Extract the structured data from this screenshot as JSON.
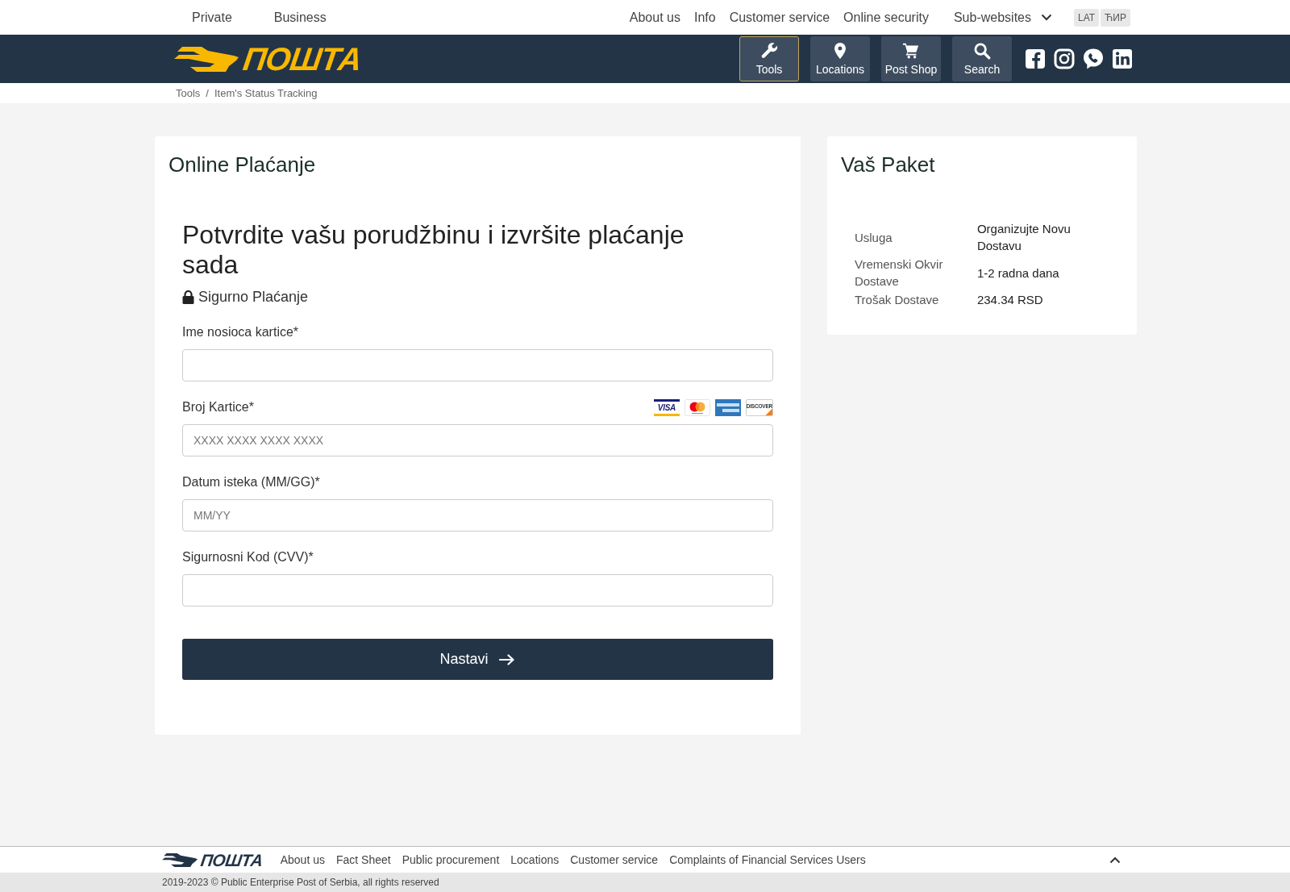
{
  "top_bar": {
    "segments": [
      "Private",
      "Business"
    ],
    "links": [
      "About us",
      "Info",
      "Customer service",
      "Online security"
    ],
    "dropdown": {
      "label": "Sub-websites"
    },
    "languages": [
      "LAT",
      "ЋИР"
    ]
  },
  "header": {
    "logo": "ПОШТА",
    "nav": [
      {
        "kind": "tools",
        "label": "Tools",
        "selected": true
      },
      {
        "kind": "locations",
        "label": "Locations",
        "selected": false
      },
      {
        "kind": "shop",
        "label": "Post Shop",
        "selected": false
      },
      {
        "kind": "search",
        "label": "Search",
        "selected": false
      }
    ]
  },
  "breadcrumb": {
    "items": [
      "Tools",
      "Item's Status Tracking"
    ],
    "separator": "/"
  },
  "payment": {
    "title": "Online Plaćanje",
    "heading": "Potvrdite vašu porudžbinu i izvršite plaćanje sada",
    "secure_note": "Sigurno Plaćanje",
    "fields": [
      {
        "label": "Ime nosioca kartice*"
      },
      {
        "label": "Broj Kartice*",
        "placeholder": "XXXX XXXX XXXX XXXX",
        "card_brands": [
          {
            "kind": "visa",
            "label": "VISA"
          },
          {
            "kind": "mastercard"
          },
          {
            "kind": "amex"
          },
          {
            "kind": "discover",
            "label": "DISCOVER"
          }
        ]
      },
      {
        "label": "Datum isteka (MM/GG)*",
        "placeholder": "MM/YY"
      },
      {
        "label": "Sigurnosni Kod (CVV)*"
      }
    ],
    "submit": "Nastavi"
  },
  "package": {
    "title": "Vaš Paket",
    "rows": [
      {
        "label": "Usluga",
        "value": "Organizujte Novu Dostavu"
      },
      {
        "label": "Vremenski Okvir Dostave",
        "value": "1-2 radna dana"
      },
      {
        "label": "Trošak Dostave",
        "value": "234.34 RSD"
      }
    ]
  },
  "footer": {
    "logo": "ПОШТА",
    "links": [
      "About us",
      "Fact Sheet",
      "Public procurement",
      "Locations",
      "Customer service",
      "Complaints of Financial Services Users"
    ],
    "copyright": "2019-2023 © Public Enterprise Post of Serbia, all rights reserved"
  }
}
